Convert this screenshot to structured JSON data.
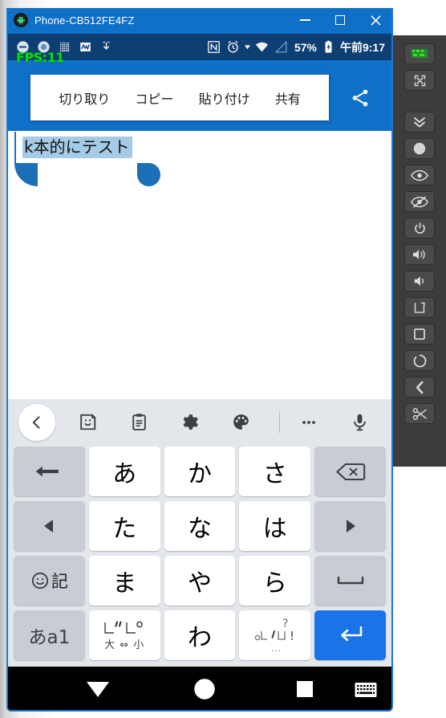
{
  "window": {
    "title": "Phone-CB512FE4FZ",
    "icon": "android-robot-icon",
    "minimize_label": "—",
    "maximize_label": "□",
    "close_label": "✕",
    "accent_color": "#0f70c8"
  },
  "status_bar": {
    "background_color": "#0d3f73",
    "left_icons": [
      "minus-circle-icon",
      "record-circle-icon",
      "chip-icon",
      "graph-activity-icon",
      "download-arrow-icon"
    ],
    "right_icons": [
      "nfc-icon",
      "alarm-icon",
      "wifi-icon",
      "cell-signal-icon"
    ],
    "battery_percent": "57%",
    "battery_icon": "battery-charging-icon",
    "clock": "午前9:17"
  },
  "fps_overlay": {
    "text": "FPS:11",
    "color": "#00e400"
  },
  "context_menu": {
    "items": [
      {
        "label": "切り取り",
        "name": "cut"
      },
      {
        "label": "コピー",
        "name": "copy"
      },
      {
        "label": "貼り付け",
        "name": "paste"
      },
      {
        "label": "共有",
        "name": "share"
      }
    ],
    "share_icon": "share-icon"
  },
  "editor": {
    "selected_text": "k本的にテスト",
    "selection_color": "#a6cbe6",
    "handle_color": "#1a6fb5"
  },
  "keyboard": {
    "toolbar": [
      {
        "name": "back-chevron",
        "icon": "chevron-left-icon"
      },
      {
        "name": "sticker",
        "icon": "sticker-icon"
      },
      {
        "name": "clipboard",
        "icon": "clipboard-icon"
      },
      {
        "name": "settings",
        "icon": "gear-icon"
      },
      {
        "name": "theme",
        "icon": "palette-icon"
      },
      {
        "name": "more",
        "icon": "ellipsis-icon"
      },
      {
        "name": "voice",
        "icon": "microphone-icon"
      }
    ],
    "rows": [
      [
        {
          "label": "",
          "type": "grey",
          "icon": "undo-arrow-icon",
          "name": "undo"
        },
        {
          "label": "あ",
          "type": "white",
          "name": "a"
        },
        {
          "label": "か",
          "type": "white",
          "name": "ka"
        },
        {
          "label": "さ",
          "type": "white",
          "name": "sa"
        },
        {
          "label": "",
          "type": "grey",
          "icon": "backspace-icon",
          "name": "backspace"
        }
      ],
      [
        {
          "label": "",
          "type": "grey",
          "icon": "arrow-left-icon",
          "name": "cursor-left"
        },
        {
          "label": "た",
          "type": "white",
          "name": "ta"
        },
        {
          "label": "な",
          "type": "white",
          "name": "na"
        },
        {
          "label": "は",
          "type": "white",
          "name": "ha"
        },
        {
          "label": "",
          "type": "grey",
          "icon": "arrow-right-icon",
          "name": "cursor-right"
        }
      ],
      [
        {
          "label": "記",
          "type": "grey",
          "icon": "smiley-icon",
          "name": "emoji-symbol"
        },
        {
          "label": "ま",
          "type": "white",
          "name": "ma"
        },
        {
          "label": "や",
          "type": "white",
          "name": "ya"
        },
        {
          "label": "ら",
          "type": "white",
          "name": "ra"
        },
        {
          "label": "",
          "type": "grey",
          "icon": "space-icon",
          "name": "space"
        }
      ],
      [
        {
          "label": "あa1",
          "type": "grey",
          "name": "input-mode"
        },
        {
          "label": "大 ⇔ 小",
          "type": "white",
          "icon": "dakuten-icon",
          "name": "dakuten"
        },
        {
          "label": "わ",
          "type": "white",
          "name": "wa"
        },
        {
          "label": "、",
          "type": "white",
          "icon": "punctuation-icon",
          "name": "punctuation"
        },
        {
          "label": "",
          "type": "blue",
          "icon": "enter-icon",
          "name": "enter"
        }
      ]
    ]
  },
  "nav_bar": {
    "buttons": [
      {
        "name": "back",
        "icon": "triangle-down-icon"
      },
      {
        "name": "home",
        "icon": "circle-icon"
      },
      {
        "name": "recents",
        "icon": "square-icon"
      },
      {
        "name": "keyboard-toggle",
        "icon": "keyboard-icon"
      }
    ]
  },
  "right_panel": {
    "background_color": "#3c3c3c",
    "buttons": [
      {
        "name": "app-green",
        "icon": "green-app-icon"
      },
      {
        "name": "fullscreen",
        "icon": "expand-icon"
      },
      {
        "name": "scroll-down",
        "icon": "chevron-double-down-icon"
      },
      {
        "name": "capture",
        "icon": "filled-circle-icon"
      },
      {
        "name": "show",
        "icon": "eye-icon"
      },
      {
        "name": "hide",
        "icon": "eye-slash-icon"
      },
      {
        "name": "power",
        "icon": "power-icon"
      },
      {
        "name": "volume-up",
        "icon": "volume-up-icon"
      },
      {
        "name": "volume-down",
        "icon": "volume-down-icon"
      },
      {
        "name": "rotate",
        "icon": "rotate-icon"
      },
      {
        "name": "recents",
        "icon": "square-icon"
      },
      {
        "name": "home",
        "icon": "circle-outline-icon"
      },
      {
        "name": "back",
        "icon": "chevron-left-icon"
      },
      {
        "name": "cut",
        "icon": "scissors-icon"
      }
    ]
  }
}
